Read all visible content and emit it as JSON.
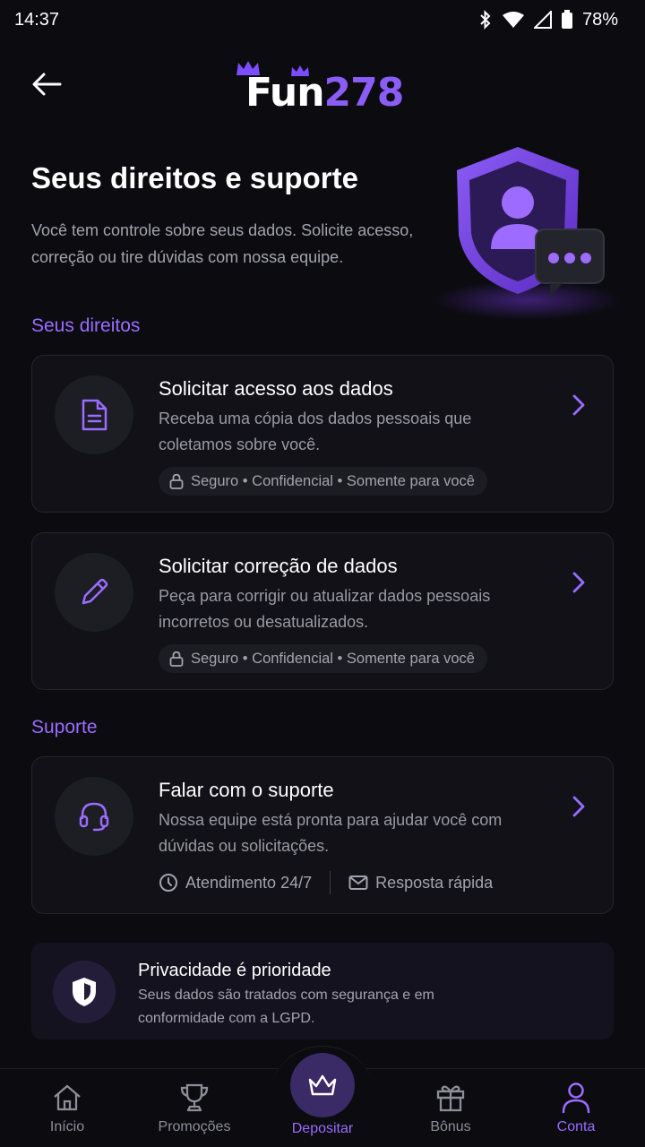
{
  "status_bar": {
    "time": "14:37",
    "battery": "78%"
  },
  "header": {
    "logo_part1": "Fun",
    "logo_part2": "278"
  },
  "hero": {
    "title": "Seus direitos e suporte",
    "subtitle": "Você tem controle sobre seus dados. Solicite acesso, correção ou tire dúvidas com nossa equipe."
  },
  "sections": {
    "rights": "Seus direitos",
    "support": "Suporte"
  },
  "cards": {
    "access": {
      "title": "Solicitar acesso aos dados",
      "desc": "Receba uma cópia dos dados pessoais que coletamos sobre você.",
      "pill": "Seguro • Confidencial • Somente para você"
    },
    "correction": {
      "title": "Solicitar correção de dados",
      "desc": "Peça para corrigir ou atualizar dados pessoais incorretos ou desatualizados.",
      "pill": "Seguro • Confidencial • Somente para você"
    },
    "support": {
      "title": "Falar com o suporte",
      "desc": "Nossa equipe está pronta para ajudar você com dúvidas ou solicitações.",
      "meta1": "Atendimento 24/7",
      "meta2": "Resposta rápida"
    }
  },
  "privacy": {
    "title": "Privacidade é prioridade",
    "desc": "Seus dados são tratados com segurança e em conformidade com a LGPD."
  },
  "nav": {
    "items": [
      {
        "label": "Início",
        "icon": "home-icon"
      },
      {
        "label": "Promoções",
        "icon": "trophy-icon"
      },
      {
        "label": "Depositar",
        "icon": "crown-icon"
      },
      {
        "label": "Bônus",
        "icon": "gift-icon"
      },
      {
        "label": "Conta",
        "icon": "user-icon"
      }
    ],
    "active": "Conta"
  },
  "colors": {
    "accent": "#9b6cff",
    "background": "#0b0b10",
    "card": "#111117"
  }
}
